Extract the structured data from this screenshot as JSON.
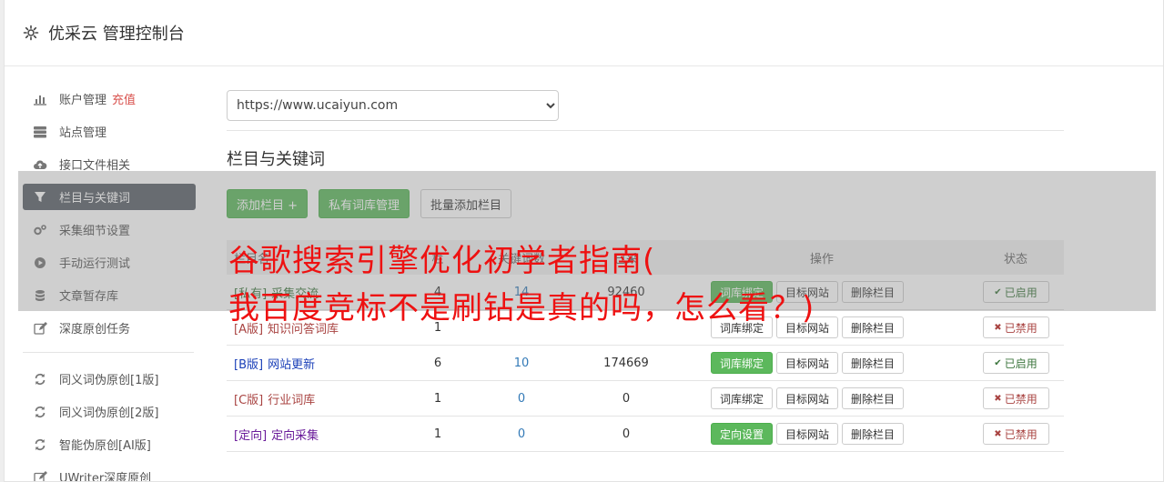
{
  "header": {
    "title": "优采云 管理控制台",
    "icon": "gear-icon"
  },
  "sidebar": {
    "groups": [
      [
        {
          "name": "account",
          "label": "账户管理",
          "extra": "充值",
          "icon": "bar-chart-icon"
        },
        {
          "name": "sites",
          "label": "站点管理",
          "icon": "server-icon"
        },
        {
          "name": "interface-files",
          "label": "接口文件相关",
          "icon": "cloud-upload-icon"
        },
        {
          "name": "columns-keywords",
          "label": "栏目与关键词",
          "icon": "filter-icon",
          "active": true
        },
        {
          "name": "collect-settings",
          "label": "采集细节设置",
          "icon": "gears-icon"
        },
        {
          "name": "manual-test",
          "label": "手动运行测试",
          "icon": "play-circle-icon"
        },
        {
          "name": "article-store",
          "label": "文章暂存库",
          "icon": "database-icon"
        },
        {
          "name": "deep-original",
          "label": "深度原创任务",
          "icon": "edit-icon"
        }
      ],
      [
        {
          "name": "synonym-1",
          "label": "同义词伪原创[1版]",
          "icon": "refresh-icon"
        },
        {
          "name": "synonym-2",
          "label": "同义词伪原创[2版]",
          "icon": "refresh-icon"
        },
        {
          "name": "ai-original",
          "label": "智能伪原创[AI版]",
          "icon": "refresh-icon"
        },
        {
          "name": "uwriter",
          "label": "UWriter深度原创",
          "icon": "edit-icon"
        }
      ]
    ]
  },
  "main": {
    "site_select": {
      "value": "https://www.ucaiyun.com",
      "options": [
        "https://www.ucaiyun.com"
      ]
    },
    "section_title": "栏目与关键词",
    "buttons": {
      "add": "添加栏目 +",
      "private_lib": "私有词库管理",
      "batch_add": "批量添加栏目"
    },
    "table": {
      "headers": {
        "name": "栏目名",
        "col2": "栏",
        "col3": "关键词数",
        "col4": "已采",
        "ops": "操作",
        "state": "状态"
      },
      "rows": [
        {
          "tag": "[私有]",
          "name": "采集交流",
          "n1": "4",
          "n2": "14",
          "n3": "92460",
          "op1": "词库绑定",
          "op1_green": true,
          "op2": "目标网站",
          "op3": "删除栏目",
          "state": "已启用",
          "on": true,
          "color": "#3c763d"
        },
        {
          "tag": "[A版]",
          "name": "知识问答词库",
          "n1": "1",
          "n2": "",
          "n3": "",
          "op1": "词库绑定",
          "op1_green": false,
          "op2": "目标网站",
          "op3": "删除栏目",
          "state": "已禁用",
          "on": false,
          "color": "#a94442"
        },
        {
          "tag": "[B版]",
          "name": "网站更新",
          "n1": "6",
          "n2": "10",
          "n3": "174669",
          "op1": "词库绑定",
          "op1_green": true,
          "op2": "目标网站",
          "op3": "删除栏目",
          "state": "已启用",
          "on": true,
          "color": "#1a3fb8"
        },
        {
          "tag": "[C版]",
          "name": "行业词库",
          "n1": "1",
          "n2": "0",
          "n3": "0",
          "op1": "词库绑定",
          "op1_green": false,
          "op2": "目标网站",
          "op3": "删除栏目",
          "state": "已禁用",
          "on": false,
          "color": "#a94442"
        },
        {
          "tag": "[定向]",
          "name": "定向采集",
          "n1": "1",
          "n2": "0",
          "n3": "0",
          "op1": "定向设置",
          "op1_green": true,
          "op2": "目标网站",
          "op3": "删除栏目",
          "state": "已禁用",
          "on": false,
          "color": "#6a1b9a"
        }
      ]
    }
  },
  "overlay": {
    "line1": "谷歌搜索引擎优化初学者指南(",
    "line2": "我百度竞标不是刷钻是真的吗，怎么看？)"
  },
  "colors": {
    "accent_green": "#5cb85c",
    "sidebar_active": "#5a6068",
    "overlay_text": "#ee1111"
  }
}
